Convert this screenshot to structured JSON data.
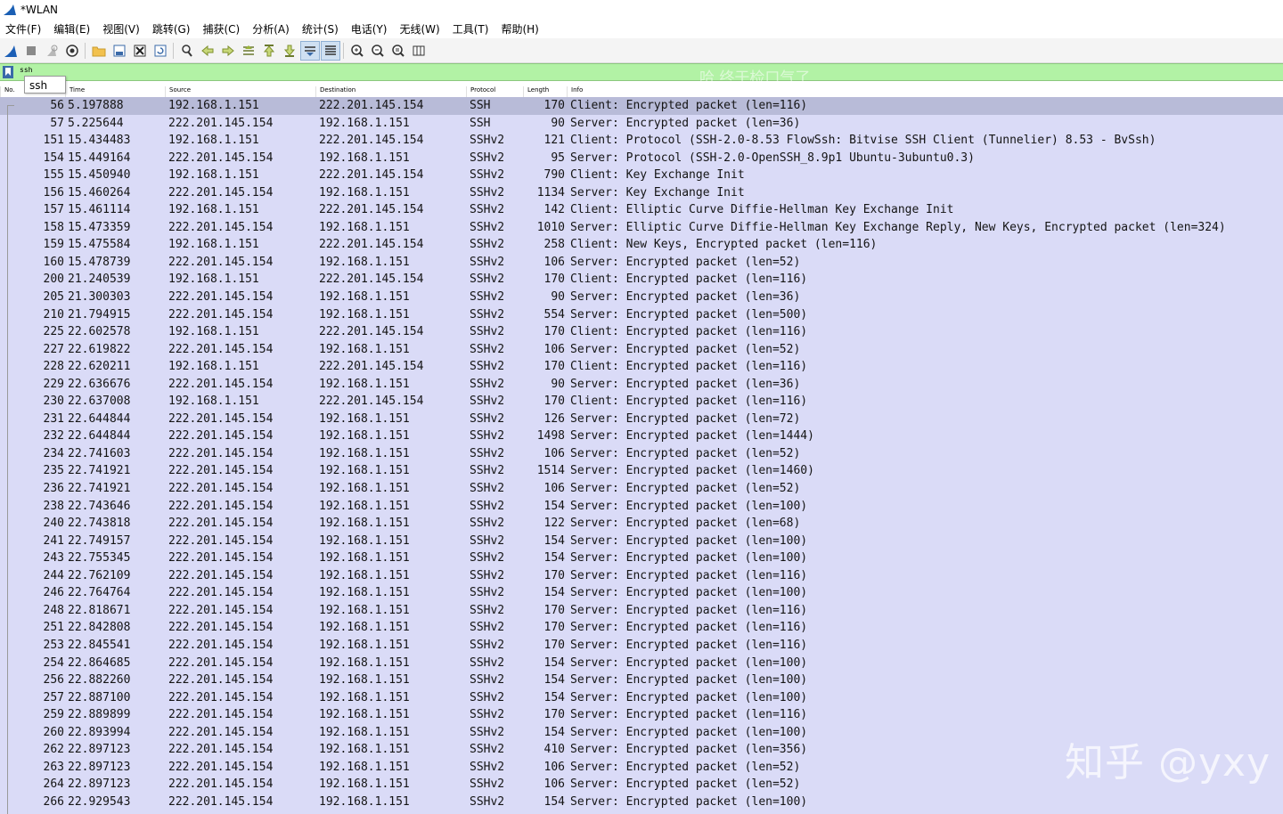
{
  "window": {
    "title": "*WLAN"
  },
  "menu": [
    "文件(F)",
    "编辑(E)",
    "视图(V)",
    "跳转(G)",
    "捕获(C)",
    "分析(A)",
    "统计(S)",
    "电话(Y)",
    "无线(W)",
    "工具(T)",
    "帮助(H)"
  ],
  "toolbar": {
    "icons": [
      "shark-fin-start-icon",
      "stop-icon",
      "restart-icon",
      "capture-options-icon",
      "open-folder-icon",
      "save-icon",
      "close-file-icon",
      "reload-icon",
      "find-icon",
      "back-arrow-icon",
      "forward-arrow-icon",
      "go-to-packet-icon",
      "first-packet-icon",
      "last-packet-icon",
      "autoscroll-icon",
      "colorize-icon",
      "zoom-in-icon",
      "zoom-out-icon",
      "zoom-normal-icon",
      "resize-columns-icon"
    ]
  },
  "filter": {
    "value": "ssh",
    "suggestion": "ssh",
    "watermark": "哈 终于检口气了"
  },
  "columns": {
    "no": "No.",
    "time": "Time",
    "source": "Source",
    "destination": "Destination",
    "protocol": "Protocol",
    "length": "Length",
    "info": "Info"
  },
  "colors": {
    "row_bg": "#dadbf7",
    "selected_bg": "#b8bbd8",
    "filter_bg": "#b2f2a5"
  },
  "packets": [
    {
      "no": "56",
      "time": "5.197888",
      "src": "192.168.1.151",
      "dst": "222.201.145.154",
      "proto": "SSH",
      "len": "170",
      "info": "Client: Encrypted packet (len=116)"
    },
    {
      "no": "57",
      "time": "5.225644",
      "src": "222.201.145.154",
      "dst": "192.168.1.151",
      "proto": "SSH",
      "len": "90",
      "info": "Server: Encrypted packet (len=36)"
    },
    {
      "no": "151",
      "time": "15.434483",
      "src": "192.168.1.151",
      "dst": "222.201.145.154",
      "proto": "SSHv2",
      "len": "121",
      "info": "Client: Protocol (SSH-2.0-8.53 FlowSsh: Bitvise SSH Client (Tunnelier) 8.53 - BvSsh)"
    },
    {
      "no": "154",
      "time": "15.449164",
      "src": "222.201.145.154",
      "dst": "192.168.1.151",
      "proto": "SSHv2",
      "len": "95",
      "info": "Server: Protocol (SSH-2.0-OpenSSH_8.9p1 Ubuntu-3ubuntu0.3)"
    },
    {
      "no": "155",
      "time": "15.450940",
      "src": "192.168.1.151",
      "dst": "222.201.145.154",
      "proto": "SSHv2",
      "len": "790",
      "info": "Client: Key Exchange Init"
    },
    {
      "no": "156",
      "time": "15.460264",
      "src": "222.201.145.154",
      "dst": "192.168.1.151",
      "proto": "SSHv2",
      "len": "1134",
      "info": "Server: Key Exchange Init"
    },
    {
      "no": "157",
      "time": "15.461114",
      "src": "192.168.1.151",
      "dst": "222.201.145.154",
      "proto": "SSHv2",
      "len": "142",
      "info": "Client: Elliptic Curve Diffie-Hellman Key Exchange Init"
    },
    {
      "no": "158",
      "time": "15.473359",
      "src": "222.201.145.154",
      "dst": "192.168.1.151",
      "proto": "SSHv2",
      "len": "1010",
      "info": "Server: Elliptic Curve Diffie-Hellman Key Exchange Reply, New Keys, Encrypted packet (len=324)"
    },
    {
      "no": "159",
      "time": "15.475584",
      "src": "192.168.1.151",
      "dst": "222.201.145.154",
      "proto": "SSHv2",
      "len": "258",
      "info": "Client: New Keys, Encrypted packet (len=116)"
    },
    {
      "no": "160",
      "time": "15.478739",
      "src": "222.201.145.154",
      "dst": "192.168.1.151",
      "proto": "SSHv2",
      "len": "106",
      "info": "Server: Encrypted packet (len=52)"
    },
    {
      "no": "200",
      "time": "21.240539",
      "src": "192.168.1.151",
      "dst": "222.201.145.154",
      "proto": "SSHv2",
      "len": "170",
      "info": "Client: Encrypted packet (len=116)"
    },
    {
      "no": "205",
      "time": "21.300303",
      "src": "222.201.145.154",
      "dst": "192.168.1.151",
      "proto": "SSHv2",
      "len": "90",
      "info": "Server: Encrypted packet (len=36)"
    },
    {
      "no": "210",
      "time": "21.794915",
      "src": "222.201.145.154",
      "dst": "192.168.1.151",
      "proto": "SSHv2",
      "len": "554",
      "info": "Server: Encrypted packet (len=500)"
    },
    {
      "no": "225",
      "time": "22.602578",
      "src": "192.168.1.151",
      "dst": "222.201.145.154",
      "proto": "SSHv2",
      "len": "170",
      "info": "Client: Encrypted packet (len=116)"
    },
    {
      "no": "227",
      "time": "22.619822",
      "src": "222.201.145.154",
      "dst": "192.168.1.151",
      "proto": "SSHv2",
      "len": "106",
      "info": "Server: Encrypted packet (len=52)"
    },
    {
      "no": "228",
      "time": "22.620211",
      "src": "192.168.1.151",
      "dst": "222.201.145.154",
      "proto": "SSHv2",
      "len": "170",
      "info": "Client: Encrypted packet (len=116)"
    },
    {
      "no": "229",
      "time": "22.636676",
      "src": "222.201.145.154",
      "dst": "192.168.1.151",
      "proto": "SSHv2",
      "len": "90",
      "info": "Server: Encrypted packet (len=36)"
    },
    {
      "no": "230",
      "time": "22.637008",
      "src": "192.168.1.151",
      "dst": "222.201.145.154",
      "proto": "SSHv2",
      "len": "170",
      "info": "Client: Encrypted packet (len=116)"
    },
    {
      "no": "231",
      "time": "22.644844",
      "src": "222.201.145.154",
      "dst": "192.168.1.151",
      "proto": "SSHv2",
      "len": "126",
      "info": "Server: Encrypted packet (len=72)"
    },
    {
      "no": "232",
      "time": "22.644844",
      "src": "222.201.145.154",
      "dst": "192.168.1.151",
      "proto": "SSHv2",
      "len": "1498",
      "info": "Server: Encrypted packet (len=1444)"
    },
    {
      "no": "234",
      "time": "22.741603",
      "src": "222.201.145.154",
      "dst": "192.168.1.151",
      "proto": "SSHv2",
      "len": "106",
      "info": "Server: Encrypted packet (len=52)"
    },
    {
      "no": "235",
      "time": "22.741921",
      "src": "222.201.145.154",
      "dst": "192.168.1.151",
      "proto": "SSHv2",
      "len": "1514",
      "info": "Server: Encrypted packet (len=1460)"
    },
    {
      "no": "236",
      "time": "22.741921",
      "src": "222.201.145.154",
      "dst": "192.168.1.151",
      "proto": "SSHv2",
      "len": "106",
      "info": "Server: Encrypted packet (len=52)"
    },
    {
      "no": "238",
      "time": "22.743646",
      "src": "222.201.145.154",
      "dst": "192.168.1.151",
      "proto": "SSHv2",
      "len": "154",
      "info": "Server: Encrypted packet (len=100)"
    },
    {
      "no": "240",
      "time": "22.743818",
      "src": "222.201.145.154",
      "dst": "192.168.1.151",
      "proto": "SSHv2",
      "len": "122",
      "info": "Server: Encrypted packet (len=68)"
    },
    {
      "no": "241",
      "time": "22.749157",
      "src": "222.201.145.154",
      "dst": "192.168.1.151",
      "proto": "SSHv2",
      "len": "154",
      "info": "Server: Encrypted packet (len=100)"
    },
    {
      "no": "243",
      "time": "22.755345",
      "src": "222.201.145.154",
      "dst": "192.168.1.151",
      "proto": "SSHv2",
      "len": "154",
      "info": "Server: Encrypted packet (len=100)"
    },
    {
      "no": "244",
      "time": "22.762109",
      "src": "222.201.145.154",
      "dst": "192.168.1.151",
      "proto": "SSHv2",
      "len": "170",
      "info": "Server: Encrypted packet (len=116)"
    },
    {
      "no": "246",
      "time": "22.764764",
      "src": "222.201.145.154",
      "dst": "192.168.1.151",
      "proto": "SSHv2",
      "len": "154",
      "info": "Server: Encrypted packet (len=100)"
    },
    {
      "no": "248",
      "time": "22.818671",
      "src": "222.201.145.154",
      "dst": "192.168.1.151",
      "proto": "SSHv2",
      "len": "170",
      "info": "Server: Encrypted packet (len=116)"
    },
    {
      "no": "251",
      "time": "22.842808",
      "src": "222.201.145.154",
      "dst": "192.168.1.151",
      "proto": "SSHv2",
      "len": "170",
      "info": "Server: Encrypted packet (len=116)"
    },
    {
      "no": "253",
      "time": "22.845541",
      "src": "222.201.145.154",
      "dst": "192.168.1.151",
      "proto": "SSHv2",
      "len": "170",
      "info": "Server: Encrypted packet (len=116)"
    },
    {
      "no": "254",
      "time": "22.864685",
      "src": "222.201.145.154",
      "dst": "192.168.1.151",
      "proto": "SSHv2",
      "len": "154",
      "info": "Server: Encrypted packet (len=100)"
    },
    {
      "no": "256",
      "time": "22.882260",
      "src": "222.201.145.154",
      "dst": "192.168.1.151",
      "proto": "SSHv2",
      "len": "154",
      "info": "Server: Encrypted packet (len=100)"
    },
    {
      "no": "257",
      "time": "22.887100",
      "src": "222.201.145.154",
      "dst": "192.168.1.151",
      "proto": "SSHv2",
      "len": "154",
      "info": "Server: Encrypted packet (len=100)"
    },
    {
      "no": "259",
      "time": "22.889899",
      "src": "222.201.145.154",
      "dst": "192.168.1.151",
      "proto": "SSHv2",
      "len": "170",
      "info": "Server: Encrypted packet (len=116)"
    },
    {
      "no": "260",
      "time": "22.893994",
      "src": "222.201.145.154",
      "dst": "192.168.1.151",
      "proto": "SSHv2",
      "len": "154",
      "info": "Server: Encrypted packet (len=100)"
    },
    {
      "no": "262",
      "time": "22.897123",
      "src": "222.201.145.154",
      "dst": "192.168.1.151",
      "proto": "SSHv2",
      "len": "410",
      "info": "Server: Encrypted packet (len=356)"
    },
    {
      "no": "263",
      "time": "22.897123",
      "src": "222.201.145.154",
      "dst": "192.168.1.151",
      "proto": "SSHv2",
      "len": "106",
      "info": "Server: Encrypted packet (len=52)"
    },
    {
      "no": "264",
      "time": "22.897123",
      "src": "222.201.145.154",
      "dst": "192.168.1.151",
      "proto": "SSHv2",
      "len": "106",
      "info": "Server: Encrypted packet (len=52)"
    },
    {
      "no": "266",
      "time": "22.929543",
      "src": "222.201.145.154",
      "dst": "192.168.1.151",
      "proto": "SSHv2",
      "len": "154",
      "info": "Server: Encrypted packet (len=100)"
    }
  ],
  "watermark": "知乎 @yxy"
}
